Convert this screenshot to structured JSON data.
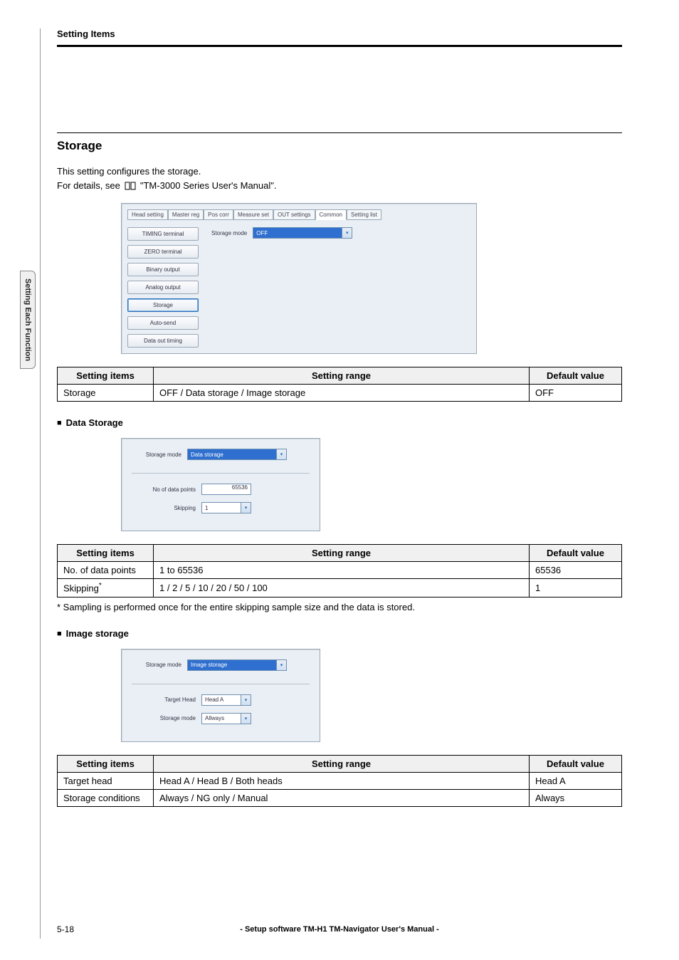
{
  "header": {
    "title": "Setting Items"
  },
  "sidetab": {
    "label": "Setting Each Function"
  },
  "section": {
    "heading": "Storage",
    "intro1": "This setting configures the storage.",
    "intro2_prefix": "For details, see ",
    "intro2_manual": "\"TM-3000 Series User's Manual\"."
  },
  "panel_main": {
    "tabs": [
      "Head setting",
      "Master reg",
      "Pos corr",
      "Measure set",
      "OUT settings",
      "Common",
      "Setting list"
    ],
    "active_tab_index": 5,
    "buttons": [
      "TIMING terminal",
      "ZERO terminal",
      "Binary output",
      "Analog output",
      "Storage",
      "Auto-send",
      "Data out timing"
    ],
    "active_button_index": 4,
    "field_label": "Storage mode",
    "field_value": "OFF"
  },
  "table_storage": {
    "headers": [
      "Setting items",
      "Setting range",
      "Default value"
    ],
    "rows": [
      {
        "item": "Storage",
        "range": "OFF / Data storage / Image storage",
        "default": "OFF"
      }
    ]
  },
  "sub_data_storage": {
    "heading": "Data Storage",
    "mode_label": "Storage mode",
    "mode_value": "Data storage",
    "points_label": "No of data points",
    "points_value": "65536",
    "skipping_label": "Skipping",
    "skipping_value": "1"
  },
  "table_data_storage": {
    "headers": [
      "Setting items",
      "Setting range",
      "Default value"
    ],
    "rows": [
      {
        "item": "No. of data points",
        "range": "1 to 65536",
        "default": "65536"
      },
      {
        "item": "Skipping",
        "has_star": true,
        "range": "1 / 2 / 5 / 10 / 20 / 50 / 100",
        "default": "1"
      }
    ],
    "footnote": "*  Sampling is performed once for the entire skipping sample size and the data is stored."
  },
  "sub_image_storage": {
    "heading": "Image storage",
    "mode_label": "Storage mode",
    "mode_value": "Image storage",
    "target_label": "Target Head",
    "target_value": "Head A",
    "cond_label": "Storage mode",
    "cond_value": "Allways"
  },
  "table_image_storage": {
    "headers": [
      "Setting items",
      "Setting range",
      "Default value"
    ],
    "rows": [
      {
        "item": "Target head",
        "range": "Head A / Head B / Both heads",
        "default": "Head A"
      },
      {
        "item": "Storage conditions",
        "range": "Always / NG only / Manual",
        "default": "Always"
      }
    ]
  },
  "footer": {
    "page": "5-18",
    "center": "- Setup software TM-H1 TM-Navigator User's Manual -"
  }
}
